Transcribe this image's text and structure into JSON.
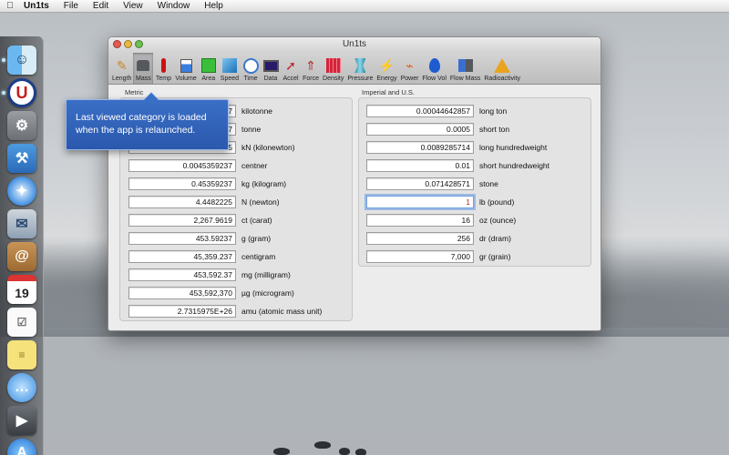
{
  "menubar": {
    "app_name": "Un1ts",
    "items": [
      "File",
      "Edit",
      "View",
      "Window",
      "Help"
    ]
  },
  "window": {
    "title": "Un1ts",
    "toolbar": [
      {
        "label": "Length",
        "icon": "ruler-icon"
      },
      {
        "label": "Mass",
        "icon": "weight-icon",
        "selected": true
      },
      {
        "label": "Temp",
        "icon": "thermometer-icon"
      },
      {
        "label": "Volume",
        "icon": "beaker-icon"
      },
      {
        "label": "Area",
        "icon": "area-square-icon"
      },
      {
        "label": "Speed",
        "icon": "speed-icon"
      },
      {
        "label": "Time",
        "icon": "clock-icon"
      },
      {
        "label": "Data",
        "icon": "monitor-icon"
      },
      {
        "label": "Accel",
        "icon": "accel-arrow-icon"
      },
      {
        "label": "Force",
        "icon": "force-arrow-icon"
      },
      {
        "label": "Density",
        "icon": "density-grid-icon"
      },
      {
        "label": "Pressure",
        "icon": "pressure-icon"
      },
      {
        "label": "Energy",
        "icon": "energy-bolt-icon"
      },
      {
        "label": "Power",
        "icon": "power-plug-icon"
      },
      {
        "label": "Flow Vol",
        "icon": "drop-icon"
      },
      {
        "label": "Flow Mass",
        "icon": "flow-mass-icon"
      },
      {
        "label": "Radioactivity",
        "icon": "radiation-icon"
      }
    ],
    "metric_group_label": "Metric",
    "imperial_group_label": "Imperial and U.S.",
    "metric_rows": [
      {
        "value": "0.00045359237",
        "unit": "kilotonne"
      },
      {
        "value": "0.00045359237",
        "unit": "tonne"
      },
      {
        "value": "0.0044482225",
        "unit": "kN  (kilonewton)"
      },
      {
        "value": "0.0045359237",
        "unit": "centner"
      },
      {
        "value": "0.45359237",
        "unit": "kg  (kilogram)"
      },
      {
        "value": "4.4482225",
        "unit": "N  (newton)"
      },
      {
        "value": "2,267.9619",
        "unit": "ct  (carat)"
      },
      {
        "value": "453.59237",
        "unit": "g  (gram)"
      },
      {
        "value": "45,359.237",
        "unit": "centigram"
      },
      {
        "value": "453,592.37",
        "unit": "mg  (milligram)"
      },
      {
        "value": "453,592,370",
        "unit": "µg  (microgram)"
      },
      {
        "value": "2.7315975E+26",
        "unit": "amu  (atomic mass unit)"
      }
    ],
    "imperial_rows": [
      {
        "value": "0.00044642857",
        "unit": "long ton"
      },
      {
        "value": "0.0005",
        "unit": "short ton"
      },
      {
        "value": "0.0089285714",
        "unit": "long hundredweight"
      },
      {
        "value": "0.01",
        "unit": "short hundredweight"
      },
      {
        "value": "0.071428571",
        "unit": "stone"
      },
      {
        "value": "1",
        "unit": "lb  (pound)",
        "focused": true
      },
      {
        "value": "16",
        "unit": "oz  (ounce)"
      },
      {
        "value": "256",
        "unit": "dr  (dram)"
      },
      {
        "value": "7,000",
        "unit": "gr  (grain)"
      }
    ]
  },
  "tooltip": {
    "text": "Last viewed category is loaded when the app is relaunched."
  },
  "dock": {
    "icons": [
      "finder-icon",
      "un1ts-app-icon",
      "system-preferences-icon",
      "xcode-icon",
      "safari-icon",
      "mail-icon",
      "address-book-icon",
      "calendar-icon",
      "reminders-icon",
      "stickies-icon",
      "messages-icon",
      "facetime-icon",
      "app-store-icon"
    ],
    "calendar_day": "19"
  },
  "colors": {
    "tooltip_bg": "#2f62bb",
    "focus_text": "#c62020",
    "selected_tab": "#a9a9a9"
  }
}
